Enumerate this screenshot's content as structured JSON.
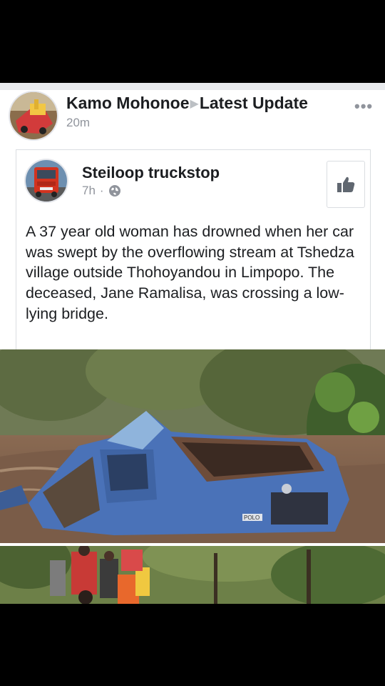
{
  "share_header": {
    "sharer_name": "Kamo Mohonoe",
    "arrow": "▶",
    "target": "Latest Update",
    "time": "20m",
    "more_label": "•••"
  },
  "shared_post": {
    "page_name": "Steiloop truckstop",
    "time": "7h",
    "separator": "·",
    "privacy_icon": "globe-icon",
    "like_icon": "thumbs-up-icon",
    "body": "A 37 year old woman has drowned when her car was swept by the overflowing stream at Tshedza village outside Thohoyandou in Limpopo. The deceased, Jane Ramalisa, was crossing a low-lying bridge."
  },
  "photos": {
    "main_plate_text": "POLO",
    "count": 2
  },
  "colors": {
    "text": "#1c1e21",
    "meta": "#90949c",
    "separator_bg": "#e9ebee",
    "car_blue": "#4a72b8"
  }
}
